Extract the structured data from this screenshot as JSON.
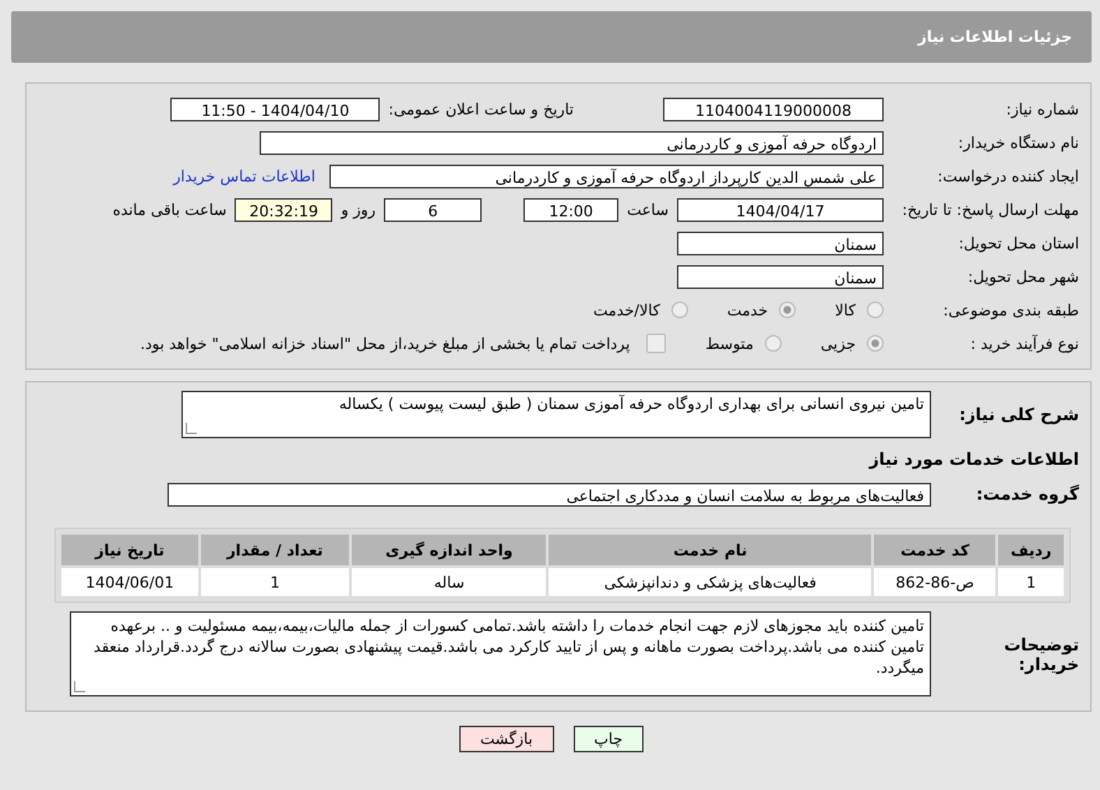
{
  "header": {
    "title": "جزئیات اطلاعات نیاز"
  },
  "need_number": {
    "label": "شماره نیاز:",
    "value": "1104004119000008"
  },
  "announce": {
    "label": "تاریخ و ساعت اعلان عمومی:",
    "value": "1404/04/10 - 11:50"
  },
  "buyer_org": {
    "label": "نام دستگاه خریدار:",
    "value": "اردوگاه حرفه آموزی و کاردرمانی"
  },
  "requester": {
    "label": "ایجاد کننده درخواست:",
    "value": "علی شمس الدین کارپرداز اردوگاه حرفه آموزی و کاردرمانی",
    "link": "اطلاعات تماس خریدار"
  },
  "deadline": {
    "label": "مهلت ارسال پاسخ: تا تاریخ:",
    "date": "1404/04/17",
    "time_label": "ساعت",
    "time": "12:00",
    "days": "6",
    "days_label": "روز و",
    "remaining": "20:32:19",
    "remaining_label": "ساعت باقی مانده"
  },
  "province": {
    "label": "استان محل تحویل:",
    "value": "سمنان"
  },
  "city": {
    "label": "شهر محل تحویل:",
    "value": "سمنان"
  },
  "category": {
    "label": "طبقه بندی موضوعی:",
    "options": [
      {
        "label": "کالا",
        "selected": false
      },
      {
        "label": "خدمت",
        "selected": true
      },
      {
        "label": "کالا/خدمت",
        "selected": false
      }
    ]
  },
  "purchase_type": {
    "label": "نوع فرآیند خرید :",
    "options": [
      {
        "label": "جزیی",
        "selected": true
      },
      {
        "label": "متوسط",
        "selected": false
      }
    ],
    "payment": {
      "label": "پرداخت تمام یا بخشی از مبلغ خرید،از محل \"اسناد خزانه اسلامی\" خواهد بود.",
      "checked": false
    }
  },
  "description": {
    "label": "شرح کلی نیاز:",
    "value": "تامین نیروی انسانی برای بهداری اردوگاه حرفه آموزی سمنان  ( طبق لیست پیوست )     یکساله"
  },
  "services_heading": "اطلاعات خدمات مورد نیاز",
  "service_group": {
    "label": "گروه خدمت:",
    "value": "فعالیت‌های مربوط به سلامت انسان و مددکاری اجتماعی"
  },
  "table": {
    "columns": [
      "ردیف",
      "کد خدمت",
      "نام خدمت",
      "واحد اندازه گیری",
      "تعداد / مقدار",
      "تاریخ نیاز"
    ],
    "rows": [
      [
        "1",
        "ص-86-862",
        "فعالیت‌های پزشکی و دندانپزشکی",
        "ساله",
        "1",
        "1404/06/01"
      ]
    ]
  },
  "buyer_notes": {
    "label": "توضیحات خریدار:",
    "value": "تامین کننده باید مجوزهای لازم جهت انجام خدمات را داشته باشد.تمامی کسورات از جمله مالیات،بیمه،بیمه مسئولیت و .. برعهده تامین کننده می باشد.پرداخت بصورت ماهانه و پس از تایید کارکرد می باشد.قیمت پیشنهادی بصورت سالانه درج گردد.قرارداد منعقد میگردد."
  },
  "buttons": [
    {
      "label": "چاپ",
      "kind": "print"
    },
    {
      "label": "بازگشت",
      "kind": "back"
    }
  ]
}
